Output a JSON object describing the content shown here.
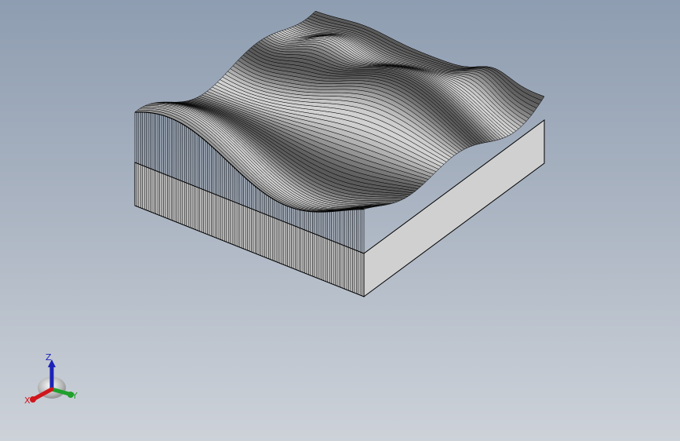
{
  "viewport": {
    "background_top": "#8e9db1",
    "background_bottom": "#cdd2d9"
  },
  "model": {
    "surface_color": "#b9b9b9",
    "line_color": "#000000",
    "side_face_color": "#d0d0d0",
    "front_face_color": "#c8c8c8"
  },
  "triad": {
    "x_label": "X",
    "y_label": "Y",
    "z_label": "Z",
    "x_color": "#d0161b",
    "y_color": "#1fa02c",
    "z_color": "#1b22b8"
  }
}
